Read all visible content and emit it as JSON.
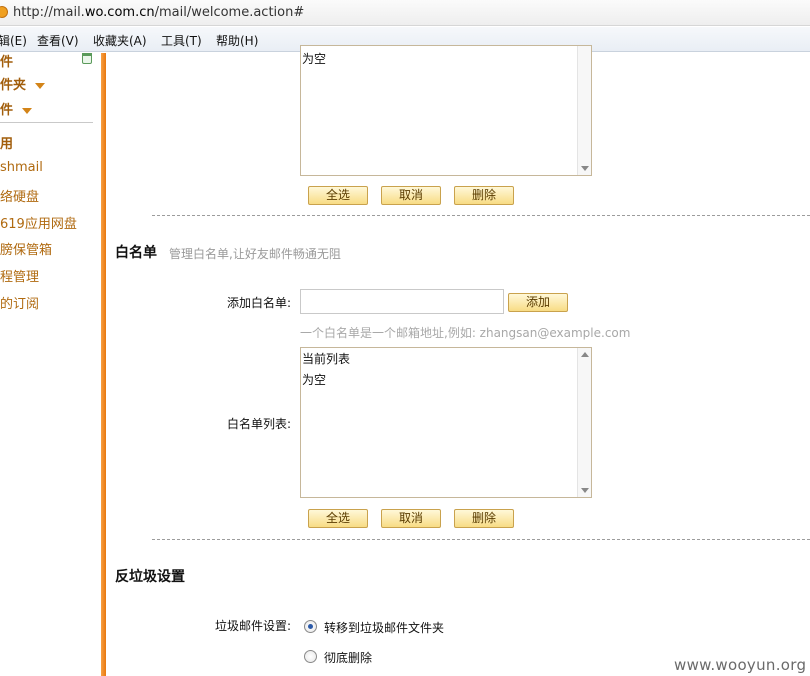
{
  "browser": {
    "url_prefix": "http://mail.",
    "url_domain": "wo.com.cn",
    "url_path": "/mail/welcome.action#",
    "menu": [
      "辑(E)",
      "查看(V)",
      "收藏夹(A)",
      "工具(T)",
      "帮助(H)"
    ]
  },
  "sidebar": {
    "items": [
      {
        "label": "件"
      },
      {
        "label": "件夹"
      },
      {
        "label": "件"
      },
      {
        "label": "用"
      },
      {
        "label": "shmail"
      },
      {
        "label": "络硬盘"
      },
      {
        "label": "619应用网盘"
      },
      {
        "label": "膀保管箱"
      },
      {
        "label": "程管理"
      },
      {
        "label": "的订阅"
      }
    ]
  },
  "blacklist": {
    "list_lines": [
      "为空"
    ],
    "buttons": {
      "select_all": "全选",
      "cancel": "取消",
      "delete": "删除"
    }
  },
  "whitelist": {
    "title": "白名单",
    "description": "管理白名单,让好友邮件畅通无阻",
    "add_label": "添加白名单:",
    "input_value": "",
    "add_button": "添加",
    "hint": "一个白名单是一个邮箱地址,例如: zhangsan@example.com",
    "list_label": "白名单列表:",
    "list_lines": [
      "当前列表",
      "为空"
    ],
    "buttons": {
      "select_all": "全选",
      "cancel": "取消",
      "delete": "删除"
    }
  },
  "antispam": {
    "title": "反垃圾设置",
    "label": "垃圾邮件设置:",
    "options": [
      {
        "label": "转移到垃圾邮件文件夹",
        "checked": true
      },
      {
        "label": "彻底删除",
        "checked": false
      }
    ]
  },
  "watermark": "www.wooyun.org",
  "colors": {
    "accent": "#ef8a1f",
    "sidebar_text": "#b06a10",
    "button_bg": "#f8dc85"
  }
}
